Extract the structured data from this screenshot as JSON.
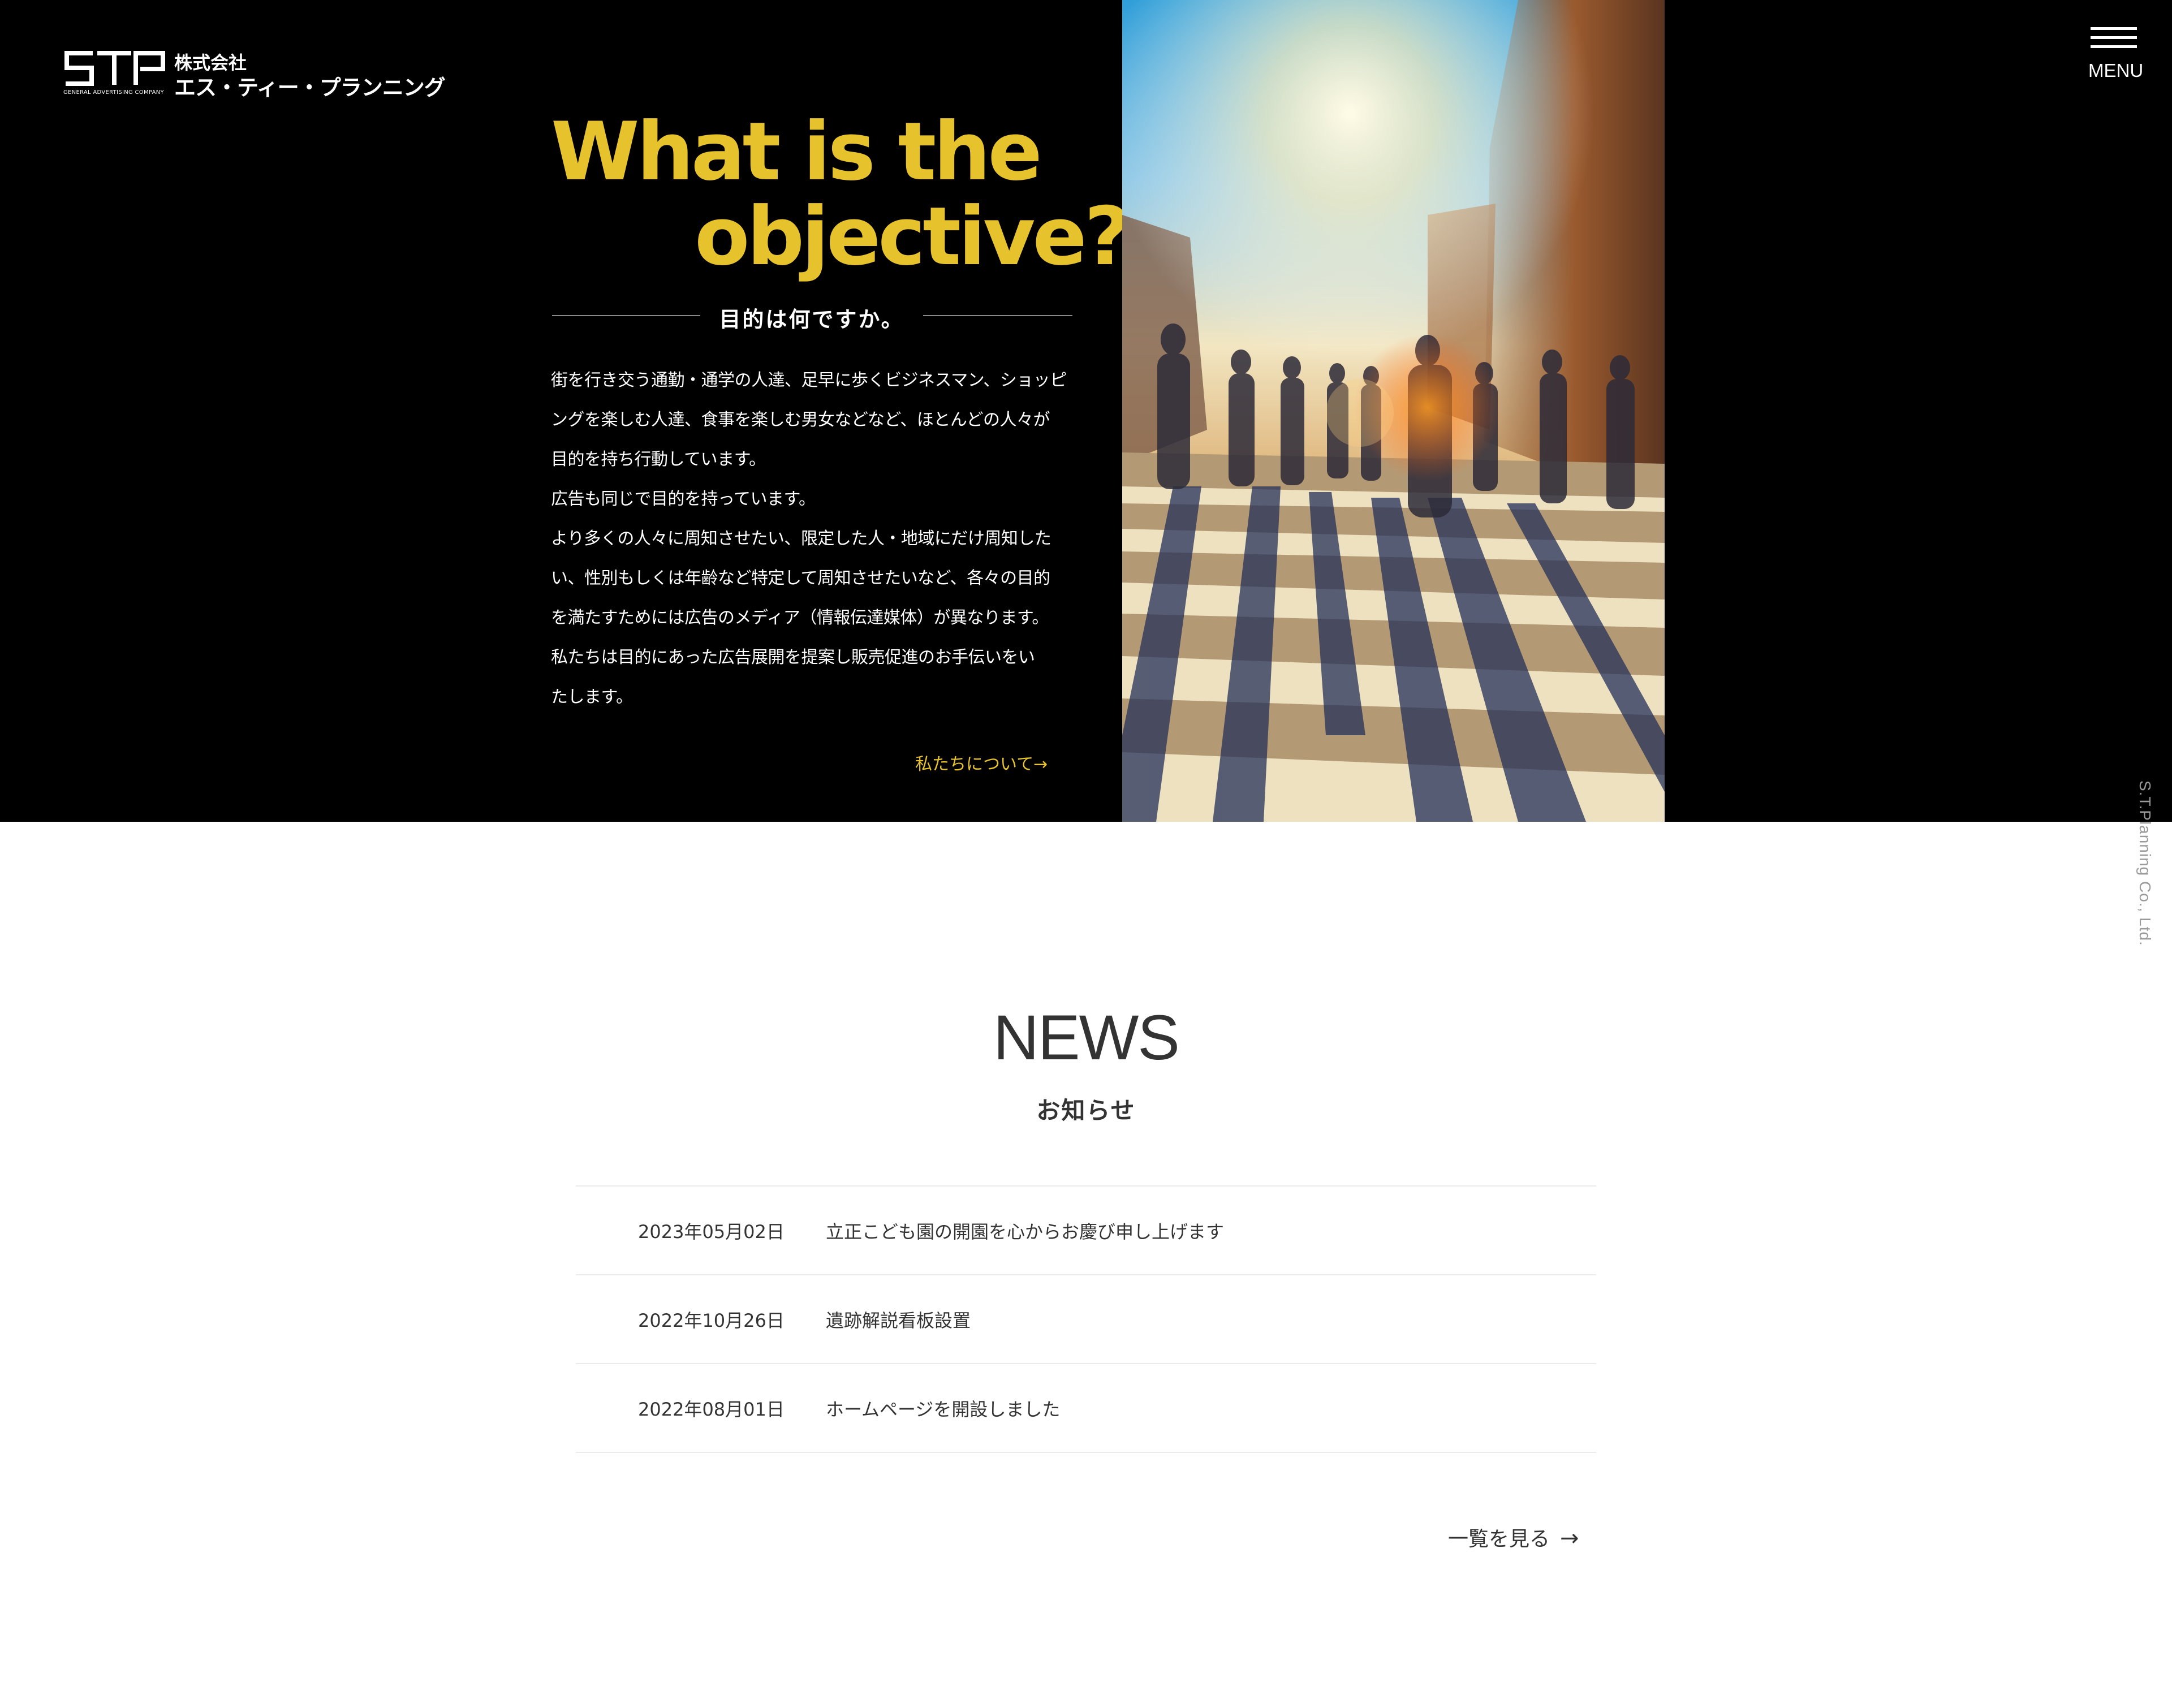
{
  "header": {
    "logo_mark": "STP",
    "logo_sub": "GENERAL ADVERTISING COMPANY",
    "logo_line1": "株式会社",
    "logo_line2": "エス・ティー・プランニング",
    "menu_label": "MENU"
  },
  "hero": {
    "title_line1": "What is the",
    "title_line2": "objective?",
    "subtitle": "目的は何ですか。",
    "body_lines": [
      "街を行き交う通勤・通学の人達、足早に歩くビジネスマン、ショッピ",
      "ングを楽しむ人達、食事を楽しむ男女などなど、ほとんどの人々が",
      "目的を持ち行動しています。",
      "広告も同じで目的を持っています。",
      "より多くの人々に周知させたい、限定した人・地域にだけ周知した",
      "い、性別もしくは年齢など特定して周知させたいなど、各々の目的",
      "を満たすためには広告のメディア（情報伝達媒体）が異なります。",
      "私たちは目的にあった広告展開を提案し販売促進のお手伝いをい",
      "たします。"
    ],
    "about_link": "私たちについて→"
  },
  "vertical_company": "S.T.Planning Co., Ltd.",
  "news": {
    "title": "NEWS",
    "subtitle": "お知らせ",
    "items": [
      {
        "date": "2023年05月02日",
        "text": "立正こども園の開園を心からお慶び申し上げます"
      },
      {
        "date": "2022年10月26日",
        "text": "遺跡解説看板設置"
      },
      {
        "date": "2022年08月01日",
        "text": "ホームページを開設しました"
      }
    ],
    "more_label": "一覧を見る",
    "more_arrow": "→"
  },
  "colors": {
    "accent": "#e6c32c",
    "hero_bg": "#000000",
    "text": "#333333",
    "divider": "#ebebeb"
  }
}
